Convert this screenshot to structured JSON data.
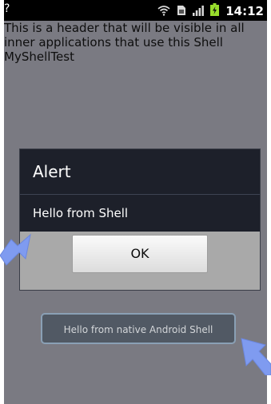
{
  "status_bar": {
    "left_glyph": "?",
    "time": "14:12",
    "icons": [
      "wifi-icon",
      "sim-icon",
      "signal-icon",
      "battery-charging-icon"
    ]
  },
  "shell": {
    "header_text": "This is a header that will be visible in all\ninner applications that use this Shell\nMyShellTest"
  },
  "dialog": {
    "title": "Alert",
    "message": "Hello from Shell",
    "ok_label": "OK"
  },
  "native_button": {
    "label": "Hello from native Android Shell"
  },
  "colors": {
    "screen_dim": "#7a7a82",
    "dialog_bg": "#1d202a",
    "dialog_footer": "#a9a9a9",
    "annotation_arrow": "#7f9bf0",
    "battery_green": "#98dd2c"
  }
}
